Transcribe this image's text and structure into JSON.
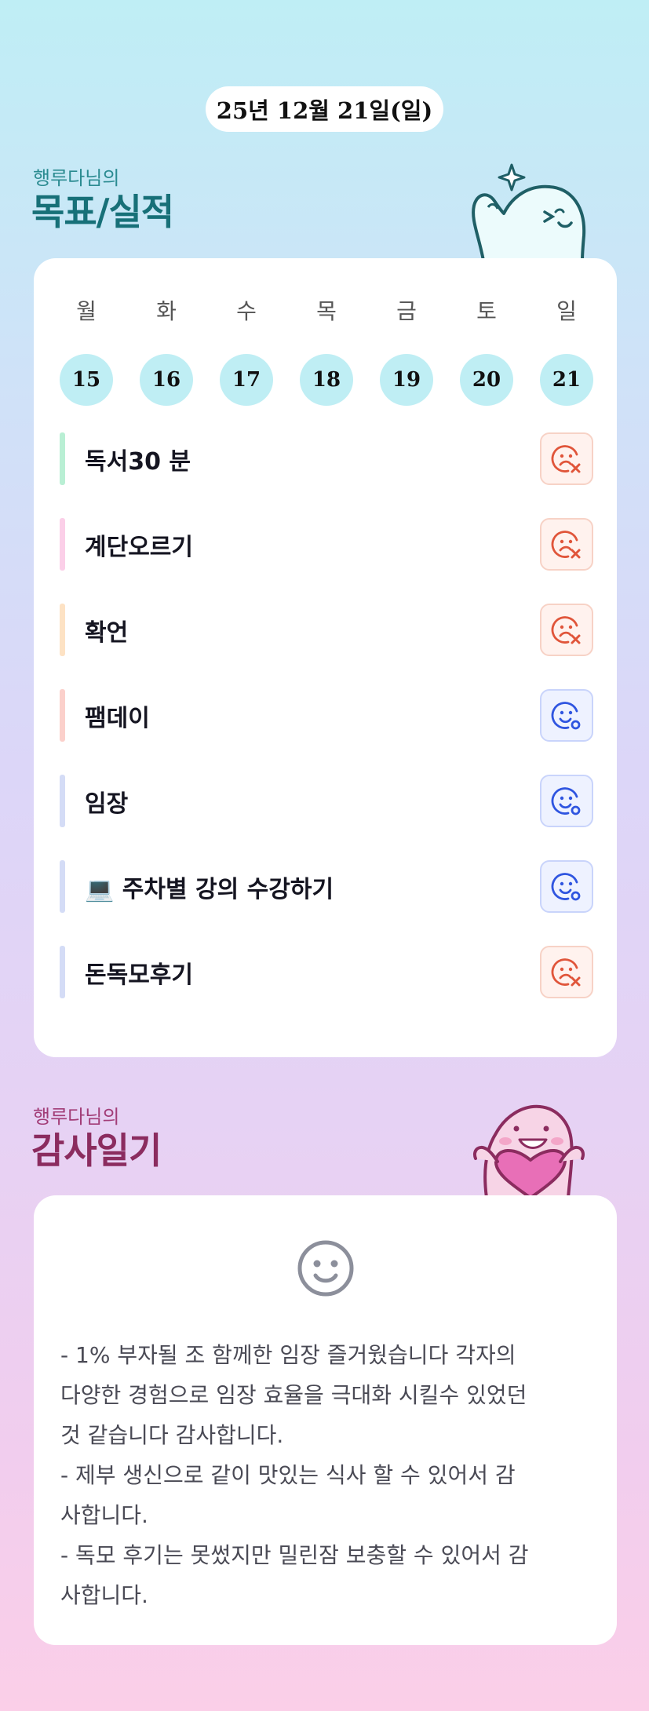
{
  "header": {
    "date": "25년 12월 21일(일)"
  },
  "goals_section": {
    "subtitle": "행루다님의",
    "title": "목표/실적",
    "days": [
      {
        "label": "월",
        "num": "15"
      },
      {
        "label": "화",
        "num": "16"
      },
      {
        "label": "수",
        "num": "17"
      },
      {
        "label": "목",
        "num": "18"
      },
      {
        "label": "금",
        "num": "19"
      },
      {
        "label": "토",
        "num": "20"
      },
      {
        "label": "일",
        "num": "21"
      }
    ],
    "items": [
      {
        "name": "독서30 분",
        "bar_color": "#b9efd4",
        "status": "fail",
        "status_icon": "sad-x-face-icon"
      },
      {
        "name": "계단오르기",
        "bar_color": "#fbcfe8",
        "status": "fail",
        "status_icon": "sad-x-face-icon"
      },
      {
        "name": "확언",
        "bar_color": "#fde2c4",
        "status": "fail",
        "status_icon": "sad-x-face-icon"
      },
      {
        "name": "팸데이",
        "bar_color": "#fbd0cb",
        "status": "done",
        "status_icon": "smile-o-face-icon"
      },
      {
        "name": "임장",
        "bar_color": "#d4dcf6",
        "status": "done",
        "status_icon": "smile-o-face-icon"
      },
      {
        "name": "💻 주차별 강의 수강하기",
        "bar_color": "#d4dcf6",
        "status": "done",
        "status_icon": "smile-o-face-icon"
      },
      {
        "name": "돈독모후기",
        "bar_color": "#d4dcf6",
        "status": "fail",
        "status_icon": "sad-x-face-icon"
      }
    ]
  },
  "gratitude_section": {
    "subtitle": "행루다님의",
    "title": "감사일기",
    "face_icon": "smile-face-icon",
    "lines": [
      "-  1% 부자될 조 함께한 임장 즐거웠습니다 각자의",
      "다양한 경험으로 임장 효율을 극대화 시킬수 있었던",
      "것 같습니다 감사합니다.",
      "- 제부 생신으로 같이 맛있는 식사 할 수 있어서 감",
      "사합니다.",
      "- 독모 후기는 못썼지만 밀린잠 보충할 수 있어서 감",
      "사합니다."
    ]
  },
  "colors": {
    "fail": "#e0553a",
    "done": "#2f55e0",
    "goal_title": "#177078",
    "gratitude_title": "#8b2c5f"
  }
}
